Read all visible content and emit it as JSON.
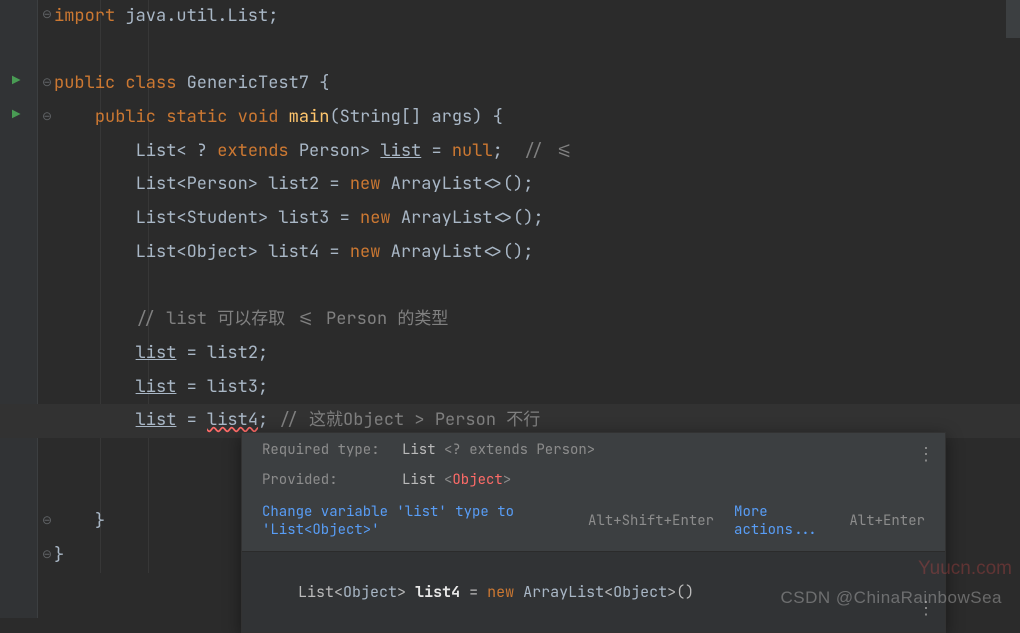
{
  "code": {
    "import_kw": "import",
    "import_pkg": " java.util.List;",
    "class_decl": {
      "public": "public",
      "class": "class",
      "name": " GenericTest7 ",
      "brace": "{"
    },
    "main_decl": {
      "public": "public",
      "static": "static",
      "void": "void",
      "name": "main",
      "params": "(String[] args) {"
    },
    "l1": {
      "a": "List< ? ",
      "extends": "extends",
      "b": " Person> ",
      "var": "list",
      "c": " = ",
      "null": "null",
      "d": ";  ",
      "comment": "// <="
    },
    "l2": {
      "a": "List<Person> list2 = ",
      "new": "new",
      "b": " ArrayList<>();"
    },
    "l3": {
      "a": "List<Student> list3 = ",
      "new": "new",
      "b": " ArrayList<>();"
    },
    "l4": {
      "a": "List<Object> list4 = ",
      "new": "new",
      "b": " ArrayList<>();"
    },
    "comment_cn": "// list 可以存取 <= Person 的类型",
    "a1": {
      "var": "list",
      "rest": " = list2;"
    },
    "a2": {
      "var": "list",
      "rest": " = list3;"
    },
    "a3": {
      "var": "list",
      "eq": " = ",
      "err": "list4",
      "semi": "; ",
      "comment": "// 这就Object > Person 不行"
    },
    "close1": "}",
    "close2": "}"
  },
  "popup": {
    "required_label": "Required type:",
    "required_val_a": "List  ",
    "required_val_b": "<? extends Person>",
    "provided_label": "Provided:",
    "provided_val_a": "List  ",
    "provided_val_b": "<",
    "provided_val_c": "Object",
    "provided_val_d": ">",
    "fix_link": "Change variable 'list' type to 'List<Object>'",
    "fix_shortcut": "Alt+Shift+Enter",
    "more_link": "More actions...",
    "more_shortcut": "Alt+Enter",
    "preview": {
      "a": "List<",
      "obj1": "Object",
      "b": "> ",
      "var": "list4",
      "c": " = ",
      "new": "new",
      "d": " ",
      "cls": "ArrayList",
      "e": "<",
      "obj2": "Object",
      "f": ">()"
    }
  },
  "watermark1": "Yuucn.com",
  "watermark2": "CSDN @ChinaRainbowSea"
}
